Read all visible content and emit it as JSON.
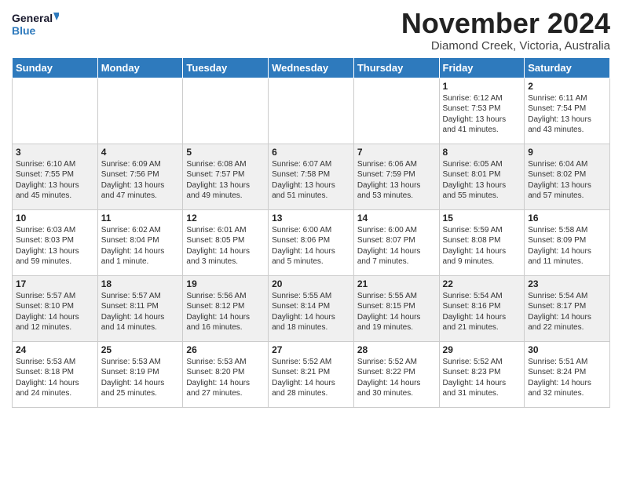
{
  "header": {
    "logo_line1": "General",
    "logo_line2": "Blue",
    "month_title": "November 2024",
    "location": "Diamond Creek, Victoria, Australia"
  },
  "weekdays": [
    "Sunday",
    "Monday",
    "Tuesday",
    "Wednesday",
    "Thursday",
    "Friday",
    "Saturday"
  ],
  "weeks": [
    [
      {
        "day": "",
        "info": ""
      },
      {
        "day": "",
        "info": ""
      },
      {
        "day": "",
        "info": ""
      },
      {
        "day": "",
        "info": ""
      },
      {
        "day": "",
        "info": ""
      },
      {
        "day": "1",
        "info": "Sunrise: 6:12 AM\nSunset: 7:53 PM\nDaylight: 13 hours\nand 41 minutes."
      },
      {
        "day": "2",
        "info": "Sunrise: 6:11 AM\nSunset: 7:54 PM\nDaylight: 13 hours\nand 43 minutes."
      }
    ],
    [
      {
        "day": "3",
        "info": "Sunrise: 6:10 AM\nSunset: 7:55 PM\nDaylight: 13 hours\nand 45 minutes."
      },
      {
        "day": "4",
        "info": "Sunrise: 6:09 AM\nSunset: 7:56 PM\nDaylight: 13 hours\nand 47 minutes."
      },
      {
        "day": "5",
        "info": "Sunrise: 6:08 AM\nSunset: 7:57 PM\nDaylight: 13 hours\nand 49 minutes."
      },
      {
        "day": "6",
        "info": "Sunrise: 6:07 AM\nSunset: 7:58 PM\nDaylight: 13 hours\nand 51 minutes."
      },
      {
        "day": "7",
        "info": "Sunrise: 6:06 AM\nSunset: 7:59 PM\nDaylight: 13 hours\nand 53 minutes."
      },
      {
        "day": "8",
        "info": "Sunrise: 6:05 AM\nSunset: 8:01 PM\nDaylight: 13 hours\nand 55 minutes."
      },
      {
        "day": "9",
        "info": "Sunrise: 6:04 AM\nSunset: 8:02 PM\nDaylight: 13 hours\nand 57 minutes."
      }
    ],
    [
      {
        "day": "10",
        "info": "Sunrise: 6:03 AM\nSunset: 8:03 PM\nDaylight: 13 hours\nand 59 minutes."
      },
      {
        "day": "11",
        "info": "Sunrise: 6:02 AM\nSunset: 8:04 PM\nDaylight: 14 hours\nand 1 minute."
      },
      {
        "day": "12",
        "info": "Sunrise: 6:01 AM\nSunset: 8:05 PM\nDaylight: 14 hours\nand 3 minutes."
      },
      {
        "day": "13",
        "info": "Sunrise: 6:00 AM\nSunset: 8:06 PM\nDaylight: 14 hours\nand 5 minutes."
      },
      {
        "day": "14",
        "info": "Sunrise: 6:00 AM\nSunset: 8:07 PM\nDaylight: 14 hours\nand 7 minutes."
      },
      {
        "day": "15",
        "info": "Sunrise: 5:59 AM\nSunset: 8:08 PM\nDaylight: 14 hours\nand 9 minutes."
      },
      {
        "day": "16",
        "info": "Sunrise: 5:58 AM\nSunset: 8:09 PM\nDaylight: 14 hours\nand 11 minutes."
      }
    ],
    [
      {
        "day": "17",
        "info": "Sunrise: 5:57 AM\nSunset: 8:10 PM\nDaylight: 14 hours\nand 12 minutes."
      },
      {
        "day": "18",
        "info": "Sunrise: 5:57 AM\nSunset: 8:11 PM\nDaylight: 14 hours\nand 14 minutes."
      },
      {
        "day": "19",
        "info": "Sunrise: 5:56 AM\nSunset: 8:12 PM\nDaylight: 14 hours\nand 16 minutes."
      },
      {
        "day": "20",
        "info": "Sunrise: 5:55 AM\nSunset: 8:14 PM\nDaylight: 14 hours\nand 18 minutes."
      },
      {
        "day": "21",
        "info": "Sunrise: 5:55 AM\nSunset: 8:15 PM\nDaylight: 14 hours\nand 19 minutes."
      },
      {
        "day": "22",
        "info": "Sunrise: 5:54 AM\nSunset: 8:16 PM\nDaylight: 14 hours\nand 21 minutes."
      },
      {
        "day": "23",
        "info": "Sunrise: 5:54 AM\nSunset: 8:17 PM\nDaylight: 14 hours\nand 22 minutes."
      }
    ],
    [
      {
        "day": "24",
        "info": "Sunrise: 5:53 AM\nSunset: 8:18 PM\nDaylight: 14 hours\nand 24 minutes."
      },
      {
        "day": "25",
        "info": "Sunrise: 5:53 AM\nSunset: 8:19 PM\nDaylight: 14 hours\nand 25 minutes."
      },
      {
        "day": "26",
        "info": "Sunrise: 5:53 AM\nSunset: 8:20 PM\nDaylight: 14 hours\nand 27 minutes."
      },
      {
        "day": "27",
        "info": "Sunrise: 5:52 AM\nSunset: 8:21 PM\nDaylight: 14 hours\nand 28 minutes."
      },
      {
        "day": "28",
        "info": "Sunrise: 5:52 AM\nSunset: 8:22 PM\nDaylight: 14 hours\nand 30 minutes."
      },
      {
        "day": "29",
        "info": "Sunrise: 5:52 AM\nSunset: 8:23 PM\nDaylight: 14 hours\nand 31 minutes."
      },
      {
        "day": "30",
        "info": "Sunrise: 5:51 AM\nSunset: 8:24 PM\nDaylight: 14 hours\nand 32 minutes."
      }
    ]
  ]
}
